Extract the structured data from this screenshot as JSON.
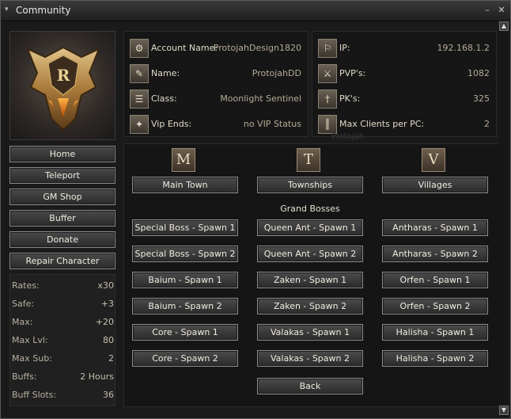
{
  "window": {
    "title": "Community"
  },
  "sidebar": {
    "buttons": [
      "Home",
      "Teleport",
      "GM Shop",
      "Buffer",
      "Donate",
      "Repair Character"
    ]
  },
  "stats": [
    {
      "label": "Rates:",
      "value": "x30"
    },
    {
      "label": "Safe:",
      "value": "+3"
    },
    {
      "label": "Max:",
      "value": "+20"
    },
    {
      "label": "Max Lvl:",
      "value": "80"
    },
    {
      "label": "Max Sub:",
      "value": "2"
    },
    {
      "label": "Buffs:",
      "value": "2 Hours"
    },
    {
      "label": "Buff Slots:",
      "value": "36"
    }
  ],
  "account": [
    {
      "icon": "account-icon",
      "label": "Account Name:",
      "value": "ProtojahDesign1820"
    },
    {
      "icon": "name-icon",
      "label": "Name:",
      "value": "ProtojahDD"
    },
    {
      "icon": "class-icon",
      "label": "Class:",
      "value": "Moonlight Sentinel"
    },
    {
      "icon": "vip-icon",
      "label": "Vip Ends:",
      "value": "no VIP Status"
    }
  ],
  "server": [
    {
      "icon": "ip-icon",
      "label": "IP:",
      "value": "192.168.1.2"
    },
    {
      "icon": "pvp-icon",
      "label": "PVP's:",
      "value": "1082"
    },
    {
      "icon": "pk-icon",
      "label": "PK's:",
      "value": "325"
    },
    {
      "icon": "max-clients-icon",
      "label": "Max Clients per PC:",
      "value": "2"
    }
  ],
  "watermark": "Protojah",
  "teleport": {
    "categories": [
      {
        "letter": "M",
        "label": "Main Town"
      },
      {
        "letter": "T",
        "label": "Townships"
      },
      {
        "letter": "V",
        "label": "Villages"
      }
    ],
    "section_title": "Grand Bosses",
    "bosses": [
      [
        "Special Boss - Spawn 1",
        "Queen Ant - Spawn 1",
        "Antharas - Spawn 1"
      ],
      [
        "Special Boss - Spawn 2",
        "Queen Ant - Spawn 2",
        "Antharas - Spawn 2"
      ],
      [
        "Baium - Spawn 1",
        "Zaken - Spawn 1",
        "Orfen - Spawn 1"
      ],
      [
        "Baium - Spawn 2",
        "Zaken - Spawn 2",
        "Orfen - Spawn 2"
      ],
      [
        "Core - Spawn 1",
        "Valakas - Spawn 1",
        "Halisha - Spawn 1"
      ],
      [
        "Core - Spawn 2",
        "Valakas - Spawn 2",
        "Halisha - Spawn 2"
      ]
    ],
    "back_label": "Back"
  }
}
